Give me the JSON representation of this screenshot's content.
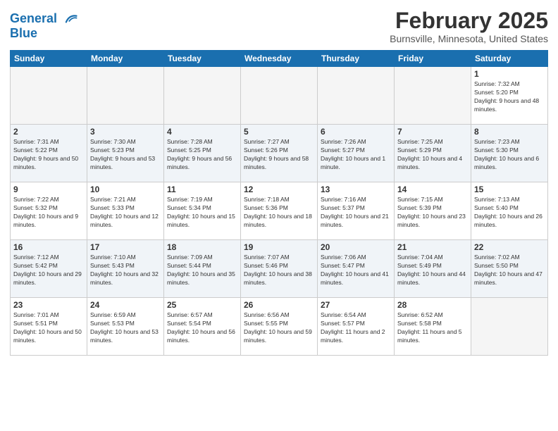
{
  "header": {
    "logo_line1": "General",
    "logo_line2": "Blue",
    "month_title": "February 2025",
    "location": "Burnsville, Minnesota, United States"
  },
  "days_of_week": [
    "Sunday",
    "Monday",
    "Tuesday",
    "Wednesday",
    "Thursday",
    "Friday",
    "Saturday"
  ],
  "weeks": [
    {
      "alt": false,
      "days": [
        {
          "num": "",
          "info": ""
        },
        {
          "num": "",
          "info": ""
        },
        {
          "num": "",
          "info": ""
        },
        {
          "num": "",
          "info": ""
        },
        {
          "num": "",
          "info": ""
        },
        {
          "num": "",
          "info": ""
        },
        {
          "num": "1",
          "info": "Sunrise: 7:32 AM\nSunset: 5:20 PM\nDaylight: 9 hours and 48 minutes."
        }
      ]
    },
    {
      "alt": true,
      "days": [
        {
          "num": "2",
          "info": "Sunrise: 7:31 AM\nSunset: 5:22 PM\nDaylight: 9 hours and 50 minutes."
        },
        {
          "num": "3",
          "info": "Sunrise: 7:30 AM\nSunset: 5:23 PM\nDaylight: 9 hours and 53 minutes."
        },
        {
          "num": "4",
          "info": "Sunrise: 7:28 AM\nSunset: 5:25 PM\nDaylight: 9 hours and 56 minutes."
        },
        {
          "num": "5",
          "info": "Sunrise: 7:27 AM\nSunset: 5:26 PM\nDaylight: 9 hours and 58 minutes."
        },
        {
          "num": "6",
          "info": "Sunrise: 7:26 AM\nSunset: 5:27 PM\nDaylight: 10 hours and 1 minute."
        },
        {
          "num": "7",
          "info": "Sunrise: 7:25 AM\nSunset: 5:29 PM\nDaylight: 10 hours and 4 minutes."
        },
        {
          "num": "8",
          "info": "Sunrise: 7:23 AM\nSunset: 5:30 PM\nDaylight: 10 hours and 6 minutes."
        }
      ]
    },
    {
      "alt": false,
      "days": [
        {
          "num": "9",
          "info": "Sunrise: 7:22 AM\nSunset: 5:32 PM\nDaylight: 10 hours and 9 minutes."
        },
        {
          "num": "10",
          "info": "Sunrise: 7:21 AM\nSunset: 5:33 PM\nDaylight: 10 hours and 12 minutes."
        },
        {
          "num": "11",
          "info": "Sunrise: 7:19 AM\nSunset: 5:34 PM\nDaylight: 10 hours and 15 minutes."
        },
        {
          "num": "12",
          "info": "Sunrise: 7:18 AM\nSunset: 5:36 PM\nDaylight: 10 hours and 18 minutes."
        },
        {
          "num": "13",
          "info": "Sunrise: 7:16 AM\nSunset: 5:37 PM\nDaylight: 10 hours and 21 minutes."
        },
        {
          "num": "14",
          "info": "Sunrise: 7:15 AM\nSunset: 5:39 PM\nDaylight: 10 hours and 23 minutes."
        },
        {
          "num": "15",
          "info": "Sunrise: 7:13 AM\nSunset: 5:40 PM\nDaylight: 10 hours and 26 minutes."
        }
      ]
    },
    {
      "alt": true,
      "days": [
        {
          "num": "16",
          "info": "Sunrise: 7:12 AM\nSunset: 5:42 PM\nDaylight: 10 hours and 29 minutes."
        },
        {
          "num": "17",
          "info": "Sunrise: 7:10 AM\nSunset: 5:43 PM\nDaylight: 10 hours and 32 minutes."
        },
        {
          "num": "18",
          "info": "Sunrise: 7:09 AM\nSunset: 5:44 PM\nDaylight: 10 hours and 35 minutes."
        },
        {
          "num": "19",
          "info": "Sunrise: 7:07 AM\nSunset: 5:46 PM\nDaylight: 10 hours and 38 minutes."
        },
        {
          "num": "20",
          "info": "Sunrise: 7:06 AM\nSunset: 5:47 PM\nDaylight: 10 hours and 41 minutes."
        },
        {
          "num": "21",
          "info": "Sunrise: 7:04 AM\nSunset: 5:49 PM\nDaylight: 10 hours and 44 minutes."
        },
        {
          "num": "22",
          "info": "Sunrise: 7:02 AM\nSunset: 5:50 PM\nDaylight: 10 hours and 47 minutes."
        }
      ]
    },
    {
      "alt": false,
      "days": [
        {
          "num": "23",
          "info": "Sunrise: 7:01 AM\nSunset: 5:51 PM\nDaylight: 10 hours and 50 minutes."
        },
        {
          "num": "24",
          "info": "Sunrise: 6:59 AM\nSunset: 5:53 PM\nDaylight: 10 hours and 53 minutes."
        },
        {
          "num": "25",
          "info": "Sunrise: 6:57 AM\nSunset: 5:54 PM\nDaylight: 10 hours and 56 minutes."
        },
        {
          "num": "26",
          "info": "Sunrise: 6:56 AM\nSunset: 5:55 PM\nDaylight: 10 hours and 59 minutes."
        },
        {
          "num": "27",
          "info": "Sunrise: 6:54 AM\nSunset: 5:57 PM\nDaylight: 11 hours and 2 minutes."
        },
        {
          "num": "28",
          "info": "Sunrise: 6:52 AM\nSunset: 5:58 PM\nDaylight: 11 hours and 5 minutes."
        },
        {
          "num": "",
          "info": ""
        }
      ]
    }
  ]
}
